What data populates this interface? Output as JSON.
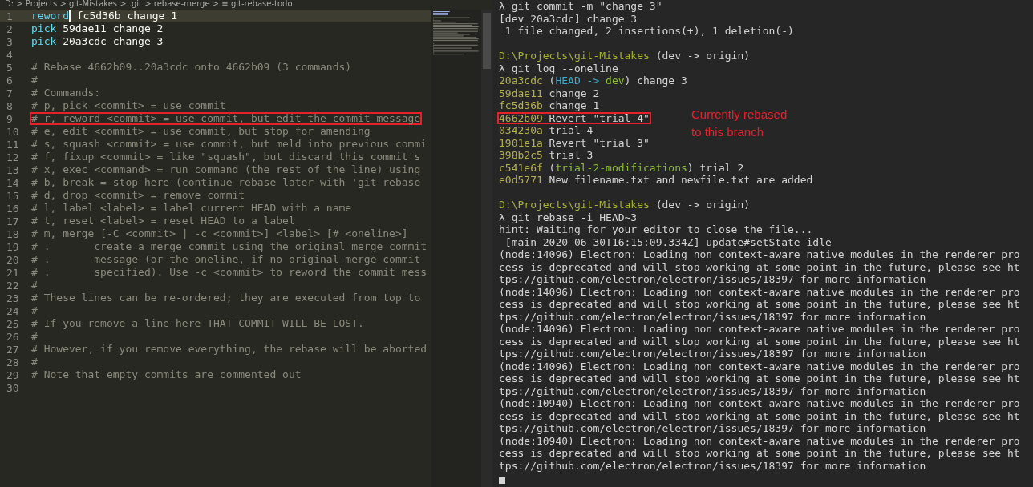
{
  "editor": {
    "breadcrumb": "D: > Projects > git-Mistakes > .git > rebase-merge > ≡ git-rebase-todo",
    "lines": [
      {
        "number": "1",
        "current": true,
        "highlighted": false,
        "tokens": [
          {
            "text": "reword",
            "kind": "keyword"
          },
          {
            "text": " fc5d36b change 1",
            "kind": "plain"
          }
        ]
      },
      {
        "number": "2",
        "current": false,
        "highlighted": false,
        "tokens": [
          {
            "text": "pick",
            "kind": "keyword"
          },
          {
            "text": " 59dae11 change 2",
            "kind": "plain"
          }
        ]
      },
      {
        "number": "3",
        "current": false,
        "highlighted": false,
        "tokens": [
          {
            "text": "pick",
            "kind": "keyword"
          },
          {
            "text": " 20a3cdc change 3",
            "kind": "plain"
          }
        ]
      },
      {
        "number": "4",
        "current": false
      },
      {
        "number": "5",
        "current": false,
        "highlighted": false,
        "tokens": [
          {
            "text": "# Rebase 4662b09..20a3cdc onto 4662b09 (3 commands)",
            "kind": "comment"
          }
        ]
      },
      {
        "number": "6",
        "current": false,
        "highlighted": false,
        "tokens": [
          {
            "text": "#",
            "kind": "comment"
          }
        ]
      },
      {
        "number": "7",
        "current": false,
        "highlighted": false,
        "tokens": [
          {
            "text": "# Commands:",
            "kind": "comment"
          }
        ]
      },
      {
        "number": "8",
        "current": false,
        "highlighted": false,
        "tokens": [
          {
            "text": "# p, pick <commit> = use commit",
            "kind": "comment"
          }
        ]
      },
      {
        "number": "9",
        "current": false,
        "highlighted": true,
        "tokens": [
          {
            "text": "# r, reword <commit> = use commit, but edit the commit message",
            "kind": "comment"
          }
        ]
      },
      {
        "number": "10",
        "current": false,
        "highlighted": false,
        "tokens": [
          {
            "text": "# e, edit <commit> = use commit, but stop for amending",
            "kind": "comment"
          }
        ]
      },
      {
        "number": "11",
        "current": false,
        "highlighted": false,
        "tokens": [
          {
            "text": "# s, squash <commit> = use commit, but meld into previous commi",
            "kind": "comment"
          }
        ]
      },
      {
        "number": "12",
        "current": false,
        "highlighted": false,
        "tokens": [
          {
            "text": "# f, fixup <commit> = like \"squash\", but discard this commit's",
            "kind": "comment"
          }
        ]
      },
      {
        "number": "13",
        "current": false,
        "highlighted": false,
        "tokens": [
          {
            "text": "# x, exec <command> = run command (the rest of the line) using",
            "kind": "comment"
          }
        ]
      },
      {
        "number": "14",
        "current": false,
        "highlighted": false,
        "tokens": [
          {
            "text": "# b, break = stop here (continue rebase later with 'git rebase",
            "kind": "comment"
          }
        ]
      },
      {
        "number": "15",
        "current": false,
        "highlighted": false,
        "tokens": [
          {
            "text": "# d, drop <commit> = remove commit",
            "kind": "comment"
          }
        ]
      },
      {
        "number": "16",
        "current": false,
        "highlighted": false,
        "tokens": [
          {
            "text": "# l, label <label> = label current HEAD with a name",
            "kind": "comment"
          }
        ]
      },
      {
        "number": "17",
        "current": false,
        "highlighted": false,
        "tokens": [
          {
            "text": "# t, reset <label> = reset HEAD to a label",
            "kind": "comment"
          }
        ]
      },
      {
        "number": "18",
        "current": false,
        "highlighted": false,
        "tokens": [
          {
            "text": "# m, merge [-C <commit> | -c <commit>] <label> [# <oneline>]",
            "kind": "comment"
          }
        ]
      },
      {
        "number": "19",
        "current": false,
        "highlighted": false,
        "tokens": [
          {
            "text": "# .       create a merge commit using the original merge commit",
            "kind": "comment"
          }
        ]
      },
      {
        "number": "20",
        "current": false,
        "highlighted": false,
        "tokens": [
          {
            "text": "# .       message (or the oneline, if no original merge commit",
            "kind": "comment"
          }
        ]
      },
      {
        "number": "21",
        "current": false,
        "highlighted": false,
        "tokens": [
          {
            "text": "# .       specified). Use -c <commit> to reword the commit mess",
            "kind": "comment"
          }
        ]
      },
      {
        "number": "22",
        "current": false,
        "highlighted": false,
        "tokens": [
          {
            "text": "#",
            "kind": "comment"
          }
        ]
      },
      {
        "number": "23",
        "current": false,
        "highlighted": false,
        "tokens": [
          {
            "text": "# These lines can be re-ordered; they are executed from top to",
            "kind": "comment"
          }
        ]
      },
      {
        "number": "24",
        "current": false,
        "highlighted": false,
        "tokens": [
          {
            "text": "#",
            "kind": "comment"
          }
        ]
      },
      {
        "number": "25",
        "current": false,
        "highlighted": false,
        "tokens": [
          {
            "text": "# If you remove a line here THAT COMMIT WILL BE LOST.",
            "kind": "comment"
          }
        ]
      },
      {
        "number": "26",
        "current": false,
        "highlighted": false,
        "tokens": [
          {
            "text": "#",
            "kind": "comment"
          }
        ]
      },
      {
        "number": "27",
        "current": false,
        "highlighted": false,
        "tokens": [
          {
            "text": "# However, if you remove everything, the rebase will be aborted",
            "kind": "comment"
          }
        ]
      },
      {
        "number": "28",
        "current": false,
        "highlighted": false,
        "tokens": [
          {
            "text": "#",
            "kind": "comment"
          }
        ]
      },
      {
        "number": "29",
        "current": false,
        "highlighted": false,
        "tokens": [
          {
            "text": "# Note that empty commits are commented out",
            "kind": "comment"
          }
        ]
      },
      {
        "number": "30",
        "current": false
      }
    ]
  },
  "terminal": {
    "annotation": "Currently rebased to this branch",
    "lines": [
      {
        "highlighted": false,
        "segments": [
          {
            "text": "λ git commit -m \"change 3\"",
            "kind": "plain"
          }
        ]
      },
      {
        "highlighted": false,
        "segments": [
          {
            "text": "[dev 20a3cdc] change 3",
            "kind": "plain"
          }
        ]
      },
      {
        "highlighted": false,
        "segments": [
          {
            "text": " 1 file changed, 2 insertions(+), 1 deletion(-)",
            "kind": "plain"
          }
        ]
      },
      {
        "kind": "blank"
      },
      {
        "highlighted": false,
        "segments": [
          {
            "text": "D:\\Projects\\git-Mistakes",
            "kind": "path"
          },
          {
            "text": " (dev -> origin)",
            "kind": "plain"
          }
        ]
      },
      {
        "highlighted": false,
        "segments": [
          {
            "text": "λ git log --oneline",
            "kind": "plain"
          }
        ]
      },
      {
        "highlighted": false,
        "segments": [
          {
            "text": "20a3cdc",
            "kind": "hash"
          },
          {
            "text": " (",
            "kind": "plain"
          },
          {
            "text": "HEAD -> ",
            "kind": "head"
          },
          {
            "text": "dev",
            "kind": "branch"
          },
          {
            "text": ") change 3",
            "kind": "plain"
          }
        ]
      },
      {
        "highlighted": false,
        "segments": [
          {
            "text": "59dae11",
            "kind": "hash"
          },
          {
            "text": " change 2",
            "kind": "plain"
          }
        ]
      },
      {
        "highlighted": false,
        "segments": [
          {
            "text": "fc5d36b",
            "kind": "hash"
          },
          {
            "text": " change 1",
            "kind": "plain"
          }
        ]
      },
      {
        "highlighted": true,
        "segments": [
          {
            "text": "4662b09",
            "kind": "hash"
          },
          {
            "text": " Revert \"trial 4\"",
            "kind": "plain"
          }
        ]
      },
      {
        "highlighted": false,
        "segments": [
          {
            "text": "034230a",
            "kind": "hash"
          },
          {
            "text": " trial 4",
            "kind": "plain"
          }
        ]
      },
      {
        "highlighted": false,
        "segments": [
          {
            "text": "1901e1a",
            "kind": "hash"
          },
          {
            "text": " Revert \"trial 3\"",
            "kind": "plain"
          }
        ]
      },
      {
        "highlighted": false,
        "segments": [
          {
            "text": "398b2c5",
            "kind": "hash"
          },
          {
            "text": " trial 3",
            "kind": "plain"
          }
        ]
      },
      {
        "highlighted": false,
        "segments": [
          {
            "text": "c541e6f",
            "kind": "hash"
          },
          {
            "text": " (",
            "kind": "plain"
          },
          {
            "text": "trial-2-modifications",
            "kind": "branch"
          },
          {
            "text": ") trial 2",
            "kind": "plain"
          }
        ]
      },
      {
        "highlighted": false,
        "segments": [
          {
            "text": "e0d5771",
            "kind": "hash"
          },
          {
            "text": " New filename.txt and newfile.txt are added",
            "kind": "plain"
          }
        ]
      },
      {
        "kind": "blank"
      },
      {
        "highlighted": false,
        "segments": [
          {
            "text": "D:\\Projects\\git-Mistakes",
            "kind": "path"
          },
          {
            "text": " (dev -> origin)",
            "kind": "plain"
          }
        ]
      },
      {
        "highlighted": false,
        "segments": [
          {
            "text": "λ git rebase -i HEAD~3",
            "kind": "plain"
          }
        ]
      },
      {
        "highlighted": false,
        "segments": [
          {
            "text": "hint: Waiting for your editor to close the file...",
            "kind": "plain"
          }
        ]
      },
      {
        "highlighted": false,
        "segments": [
          {
            "text": " [main 2020-06-30T16:15:09.334Z] update#setState idle",
            "kind": "plain"
          }
        ]
      },
      {
        "highlighted": false,
        "segments": [
          {
            "text": "(node:14096) Electron: Loading non context-aware native modules in the renderer pro",
            "kind": "plain"
          }
        ]
      },
      {
        "highlighted": false,
        "segments": [
          {
            "text": "cess is deprecated and will stop working at some point in the future, please see ht",
            "kind": "plain"
          }
        ]
      },
      {
        "highlighted": false,
        "segments": [
          {
            "text": "tps://github.com/electron/electron/issues/18397 for more information",
            "kind": "plain"
          }
        ]
      },
      {
        "highlighted": false,
        "segments": [
          {
            "text": "(node:14096) Electron: Loading non context-aware native modules in the renderer pro",
            "kind": "plain"
          }
        ]
      },
      {
        "highlighted": false,
        "segments": [
          {
            "text": "cess is deprecated and will stop working at some point in the future, please see ht",
            "kind": "plain"
          }
        ]
      },
      {
        "highlighted": false,
        "segments": [
          {
            "text": "tps://github.com/electron/electron/issues/18397 for more information",
            "kind": "plain"
          }
        ]
      },
      {
        "highlighted": false,
        "segments": [
          {
            "text": "(node:14096) Electron: Loading non context-aware native modules in the renderer pro",
            "kind": "plain"
          }
        ]
      },
      {
        "highlighted": false,
        "segments": [
          {
            "text": "cess is deprecated and will stop working at some point in the future, please see ht",
            "kind": "plain"
          }
        ]
      },
      {
        "highlighted": false,
        "segments": [
          {
            "text": "tps://github.com/electron/electron/issues/18397 for more information",
            "kind": "plain"
          }
        ]
      },
      {
        "highlighted": false,
        "segments": [
          {
            "text": "(node:14096) Electron: Loading non context-aware native modules in the renderer pro",
            "kind": "plain"
          }
        ]
      },
      {
        "highlighted": false,
        "segments": [
          {
            "text": "cess is deprecated and will stop working at some point in the future, please see ht",
            "kind": "plain"
          }
        ]
      },
      {
        "highlighted": false,
        "segments": [
          {
            "text": "tps://github.com/electron/electron/issues/18397 for more information",
            "kind": "plain"
          }
        ]
      },
      {
        "highlighted": false,
        "segments": [
          {
            "text": "(node:10940) Electron: Loading non context-aware native modules in the renderer pro",
            "kind": "plain"
          }
        ]
      },
      {
        "highlighted": false,
        "segments": [
          {
            "text": "cess is deprecated and will stop working at some point in the future, please see ht",
            "kind": "plain"
          }
        ]
      },
      {
        "highlighted": false,
        "segments": [
          {
            "text": "tps://github.com/electron/electron/issues/18397 for more information",
            "kind": "plain"
          }
        ]
      },
      {
        "highlighted": false,
        "segments": [
          {
            "text": "(node:10940) Electron: Loading non context-aware native modules in the renderer pro",
            "kind": "plain"
          }
        ]
      },
      {
        "highlighted": false,
        "segments": [
          {
            "text": "cess is deprecated and will stop working at some point in the future, please see ht",
            "kind": "plain"
          }
        ]
      },
      {
        "highlighted": false,
        "segments": [
          {
            "text": "tps://github.com/electron/electron/issues/18397 for more information",
            "kind": "plain"
          }
        ]
      }
    ]
  }
}
